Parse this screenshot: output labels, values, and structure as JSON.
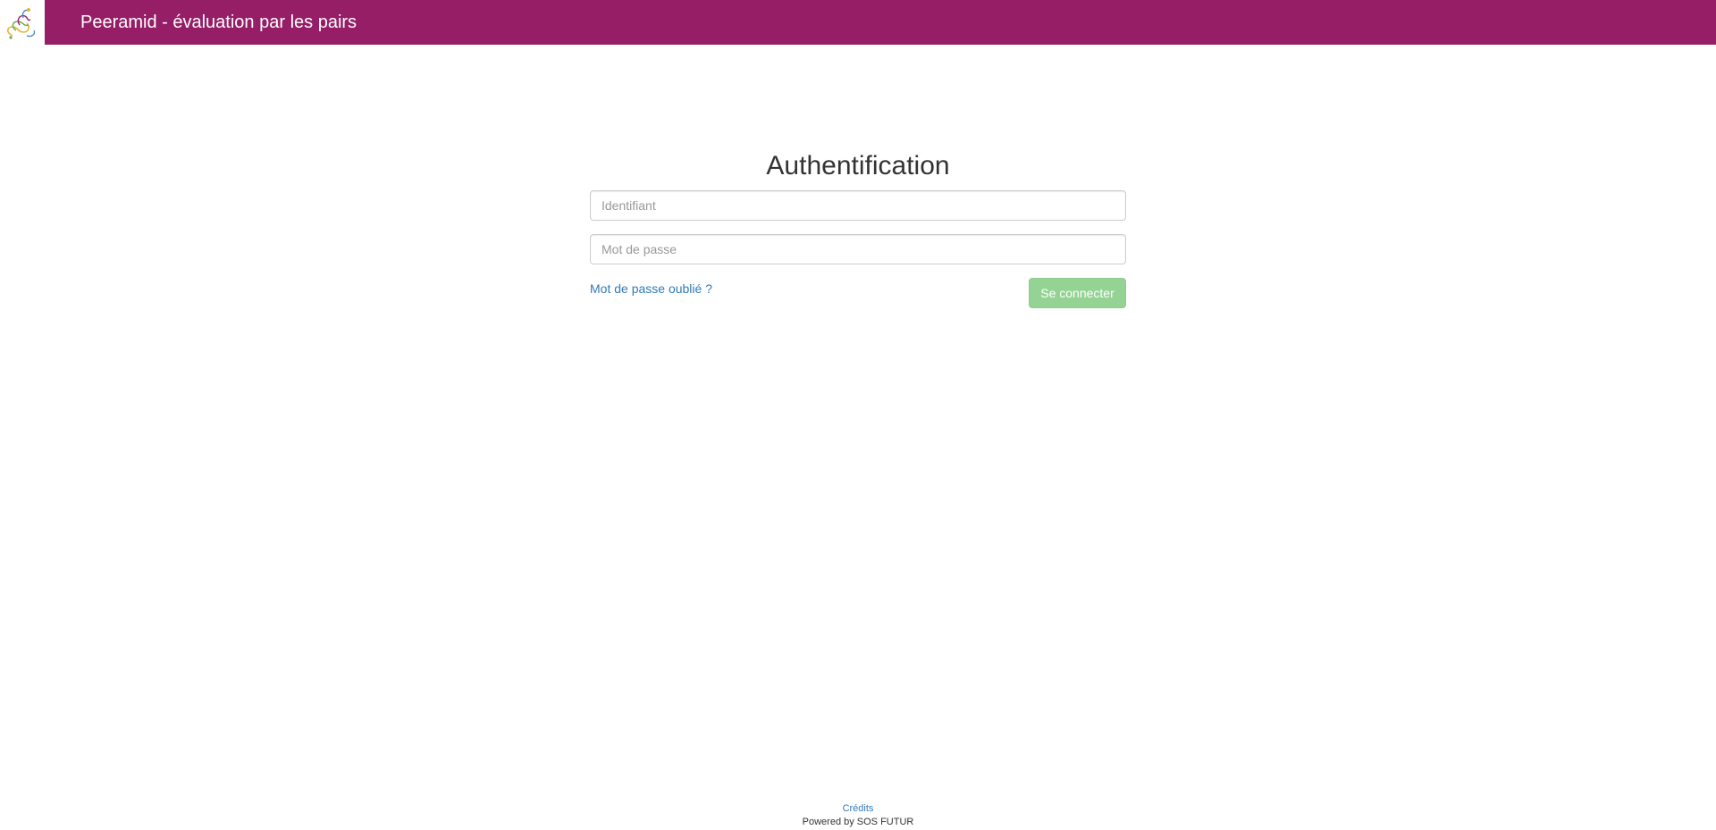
{
  "header": {
    "title": "Peeramid - évaluation par les pairs",
    "logo_icon": "peeramid-logo-icon",
    "background_color": "#951e66"
  },
  "login": {
    "title": "Authentification",
    "username_placeholder": "Identifiant",
    "username_value": "",
    "password_placeholder": "Mot de passe",
    "password_value": "",
    "forgot_password_label": "Mot de passe oublié ?",
    "submit_label": "Se connecter",
    "submit_color": "#94d394",
    "link_color": "#337ab7"
  },
  "footer": {
    "credits_label": "Crédits",
    "powered_by": "Powered by SOS FUTUR"
  }
}
